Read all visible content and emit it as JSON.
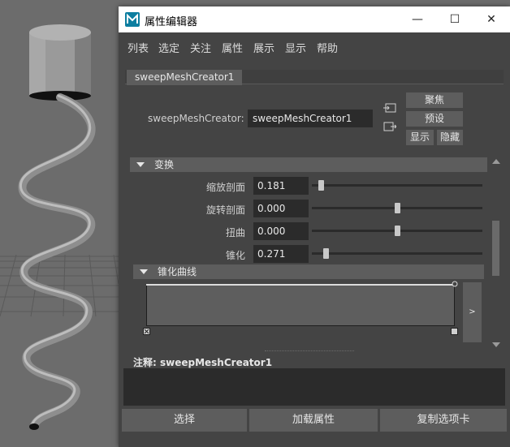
{
  "window": {
    "title": "属性编辑器",
    "minimize": "—",
    "maximize": "☐",
    "close": "✕"
  },
  "menu": [
    "列表",
    "选定",
    "关注",
    "属性",
    "展示",
    "显示",
    "帮助"
  ],
  "tab": {
    "label": "sweepMeshCreator1"
  },
  "node": {
    "label": "sweepMeshCreator:",
    "value": "sweepMeshCreator1",
    "buttons": {
      "focus": "聚焦",
      "presets": "预设",
      "show": "显示",
      "hide": "隐藏"
    }
  },
  "sections": {
    "transform": {
      "title": "变换"
    },
    "taper_curve": {
      "title": "锥化曲线"
    }
  },
  "attributes": [
    {
      "label": "缩放剖面",
      "value": "0.181",
      "slider": 0.04
    },
    {
      "label": "旋转剖面",
      "value": "0.000",
      "slider": 0.5
    },
    {
      "label": "扭曲",
      "value": "0.000",
      "slider": 0.5
    },
    {
      "label": "锥化",
      "value": "0.271",
      "slider": 0.07
    }
  ],
  "ramp": {
    "expand_label": ">"
  },
  "notes": {
    "label": "注释: sweepMeshCreator1",
    "value": ""
  },
  "bottom_buttons": {
    "select": "选择",
    "load_attributes": "加载属性",
    "copy_tab": "复制选项卡"
  },
  "colors": {
    "panel": "#444444",
    "field": "#2b2b2b",
    "button": "#5d5d5d",
    "viewport": "#6c6c6c"
  }
}
